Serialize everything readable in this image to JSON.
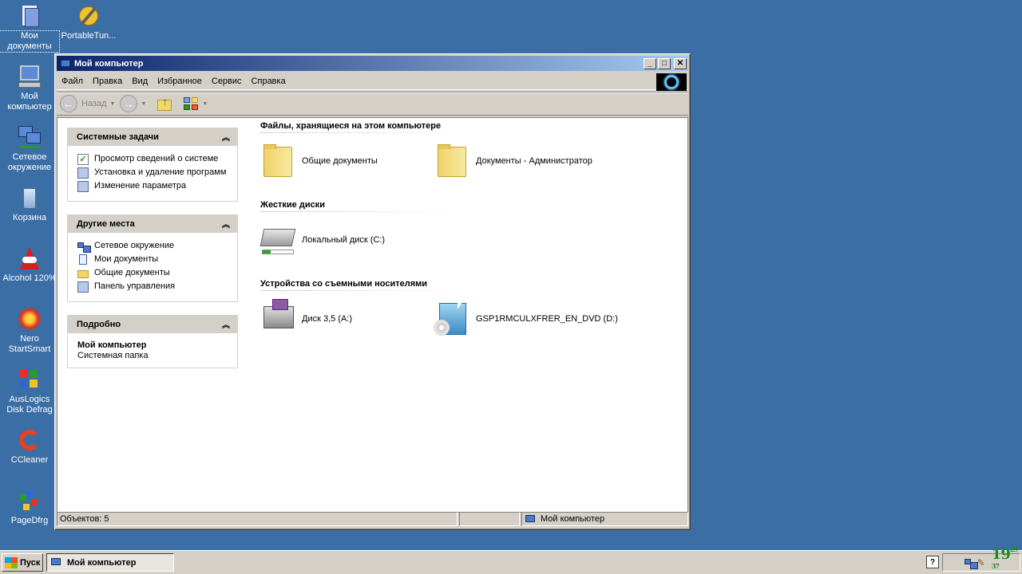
{
  "desktop": {
    "icons": [
      {
        "label": "Мои документы"
      },
      {
        "label": "PortableTun..."
      },
      {
        "label": "Мой компьютер"
      },
      {
        "label": "Сетевое окружение"
      },
      {
        "label": "Корзина"
      },
      {
        "label": "Alcohol 120%"
      },
      {
        "label": "Nero StartSmart"
      },
      {
        "label": "AusLogics Disk Defrag"
      },
      {
        "label": "CCleaner"
      },
      {
        "label": "PageDfrg"
      }
    ]
  },
  "window": {
    "title": "Мой компьютер",
    "controls": {
      "minimize": "_",
      "maximize": "□",
      "close": "✕"
    },
    "menu": [
      "Файл",
      "Правка",
      "Вид",
      "Избранное",
      "Сервис",
      "Справка"
    ],
    "toolbar": {
      "back_label": "Назад"
    },
    "taskpane": {
      "system_tasks": {
        "title": "Системные задачи",
        "items": [
          "Просмотр сведений о системе",
          "Установка и удаление программ",
          "Изменение параметра"
        ]
      },
      "other_places": {
        "title": "Другие места",
        "items": [
          "Сетевое окружение",
          "Мои документы",
          "Общие документы",
          "Панель управления"
        ]
      },
      "details": {
        "title": "Подробно",
        "name": "Мой компьютер",
        "type": "Системная папка"
      }
    },
    "groups": {
      "files": {
        "title": "Файлы, хранящиеся на этом компьютере",
        "items": [
          "Общие документы",
          "Документы - Администратор"
        ]
      },
      "hdd": {
        "title": "Жесткие диски",
        "items": [
          "Локальный диск (C:)"
        ]
      },
      "removable": {
        "title": "Устройства со съемными носителями",
        "items": [
          "Диск 3,5 (A:)",
          "GSP1RMCULXFRER_EN_DVD (D:)"
        ]
      }
    },
    "statusbar": {
      "objects": "Объектов: 5",
      "location": "Мой компьютер"
    }
  },
  "taskbar": {
    "start_label": "Пуск",
    "task_label": "Мой компьютер",
    "help": "?",
    "clock_hour": "19",
    "clock_min": "29",
    "clock_sec": "37"
  },
  "colors": {
    "desktop": "#3a6ea5",
    "titlebar_start": "#0a246a",
    "titlebar_end": "#a6caf0",
    "clock": "#1f8a1f"
  }
}
